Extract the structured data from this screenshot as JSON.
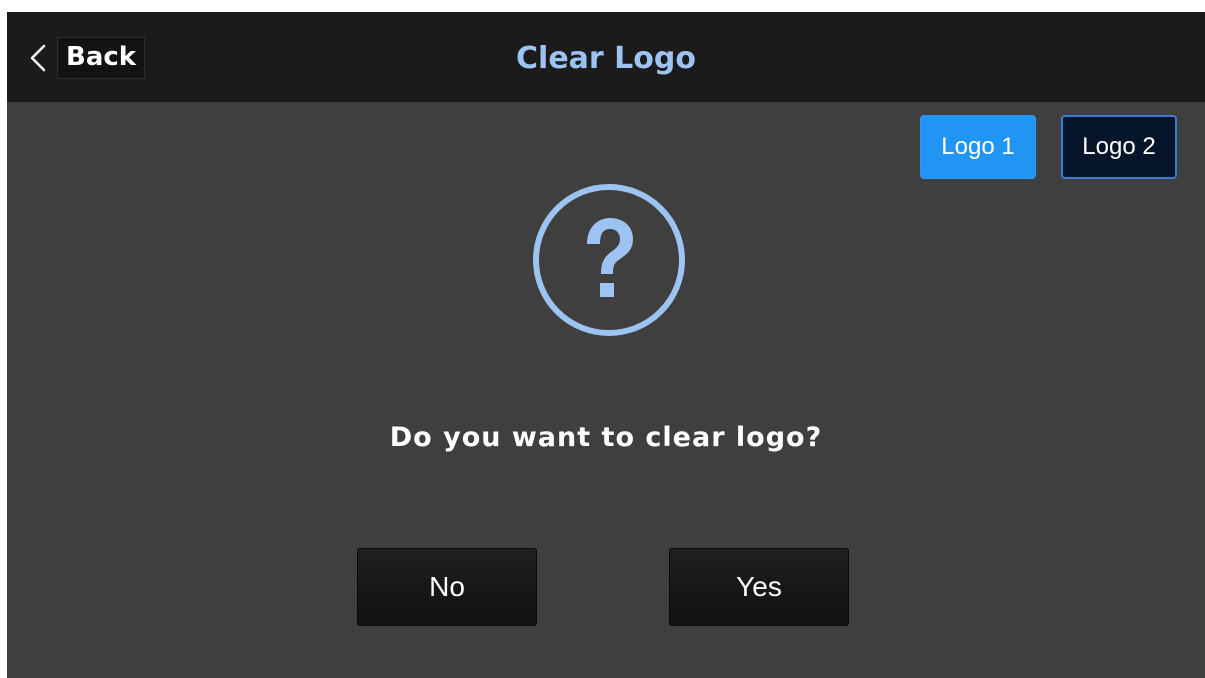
{
  "header": {
    "back_label": "Back",
    "title": "Clear Logo"
  },
  "logo_tabs": [
    {
      "label": "Logo 1",
      "selected": true
    },
    {
      "label": "Logo 2",
      "selected": false
    }
  ],
  "dialog": {
    "icon": "question-circle-icon",
    "message": "Do you want to clear logo?",
    "no_label": "No",
    "yes_label": "Yes"
  },
  "colors": {
    "accent": "#9dc3f2",
    "selected_tab": "#2195f3",
    "unselected_tab": "#07152a",
    "background": "#3f3f3f",
    "header_bg": "#1b1b1b"
  }
}
